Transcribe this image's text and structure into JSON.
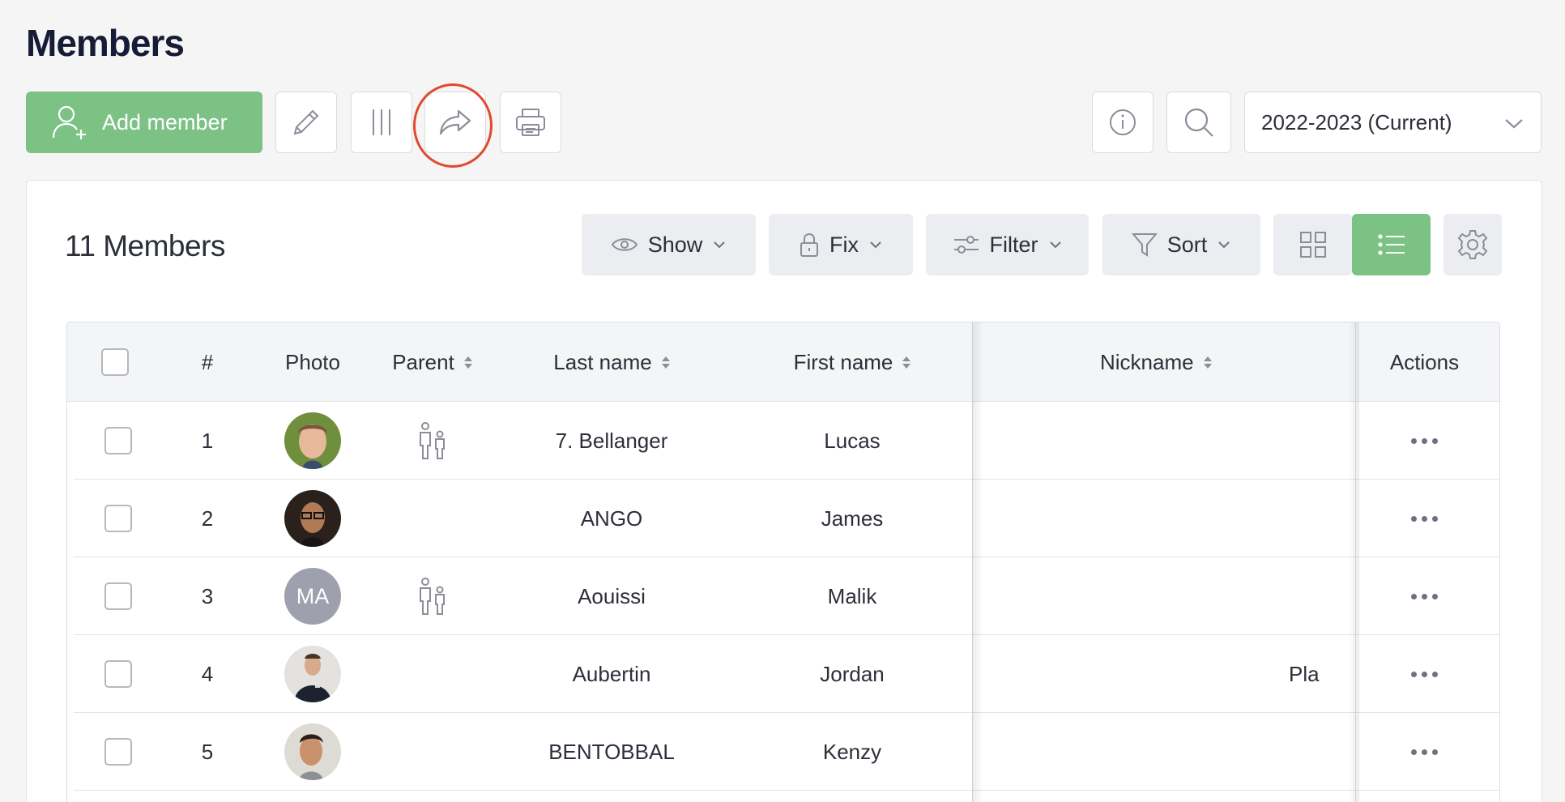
{
  "page": {
    "title": "Members"
  },
  "toolbar": {
    "add_member_label": "Add member",
    "edit_icon": "pencil-icon",
    "columns_icon": "columns-icon",
    "share_icon": "share-arrow-icon",
    "print_icon": "printer-icon",
    "info_icon": "info-icon",
    "search_icon": "search-icon",
    "season": {
      "selected": "2022-2023 (Current)"
    }
  },
  "panel": {
    "count_label": "11 Members",
    "controls": {
      "show": "Show",
      "fix": "Fix",
      "filter": "Filter",
      "sort": "Sort"
    }
  },
  "table": {
    "columns": {
      "num": "#",
      "photo": "Photo",
      "parent": "Parent",
      "last_name": "Last name",
      "first_name": "First name",
      "nickname": "Nickname",
      "actions": "Actions"
    },
    "rows": [
      {
        "num": "1",
        "photo": "photo",
        "initials": "",
        "parent": true,
        "last_name": "7. Bellanger",
        "first_name": "Lucas",
        "overflow": ""
      },
      {
        "num": "2",
        "photo": "photo",
        "initials": "",
        "parent": false,
        "last_name": "ANGO",
        "first_name": "James",
        "overflow": ""
      },
      {
        "num": "3",
        "photo": "initials",
        "initials": "MA",
        "parent": true,
        "last_name": "Aouissi",
        "first_name": "Malik",
        "overflow": ""
      },
      {
        "num": "4",
        "photo": "photo",
        "initials": "",
        "parent": false,
        "last_name": "Aubertin",
        "first_name": "Jordan",
        "overflow": "Pla"
      },
      {
        "num": "5",
        "photo": "photo",
        "initials": "",
        "parent": false,
        "last_name": "BENTOBBAL",
        "first_name": "Kenzy",
        "overflow": ""
      }
    ]
  },
  "colors": {
    "accent": "#7cc285",
    "highlight": "#e0492f"
  }
}
